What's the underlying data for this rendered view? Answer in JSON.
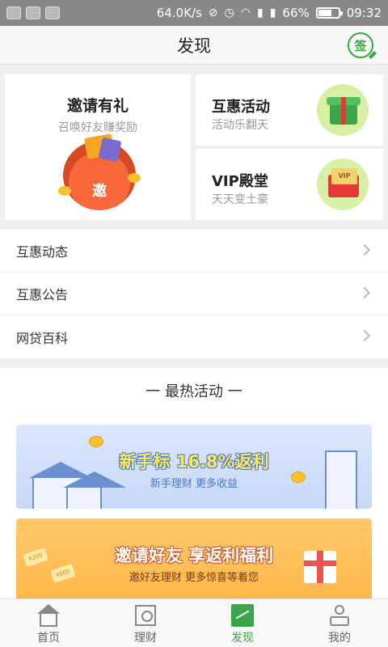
{
  "status_bar": {
    "network_speed": "64.0K/s",
    "battery": "66%",
    "battery_level": 0.66,
    "time": "09:32",
    "icons": [
      "notification-icon",
      "mute-icon",
      "alarm-icon",
      "wifi-icon",
      "signal-icon",
      "signal-icon",
      "battery-icon"
    ]
  },
  "header": {
    "title": "发现",
    "signin_label": "签"
  },
  "cards": {
    "invite": {
      "title": "邀请有礼",
      "subtitle": "召唤好友赚奖励",
      "art_char": "邀"
    },
    "mutual": {
      "title": "互惠活动",
      "subtitle": "活动乐翻天"
    },
    "vip": {
      "title": "VIP殿堂",
      "subtitle": "天天变土豪",
      "art_text": "VIP"
    }
  },
  "list": [
    {
      "label": "互惠动态"
    },
    {
      "label": "互惠公告"
    },
    {
      "label": "网贷百科"
    }
  ],
  "hot": {
    "title": "一 最热活动 一",
    "banners": [
      {
        "headline": "新手标  16.8%返利",
        "tagline": "新手理财  更多收益"
      },
      {
        "headline": "邀请好友  享返利福利",
        "tagline": "邀好友理财  更多惊喜等着您",
        "tickets": [
          "¥200",
          "¥600"
        ]
      }
    ]
  },
  "bottom_nav": [
    {
      "label": "首页",
      "icon": "home-icon"
    },
    {
      "label": "理财",
      "icon": "finance-icon"
    },
    {
      "label": "发现",
      "icon": "discover-icon",
      "active": true
    },
    {
      "label": "我的",
      "icon": "profile-icon"
    }
  ],
  "colors": {
    "accent": "#3aa54a",
    "status_bar": "#888888",
    "background": "#efefef"
  }
}
